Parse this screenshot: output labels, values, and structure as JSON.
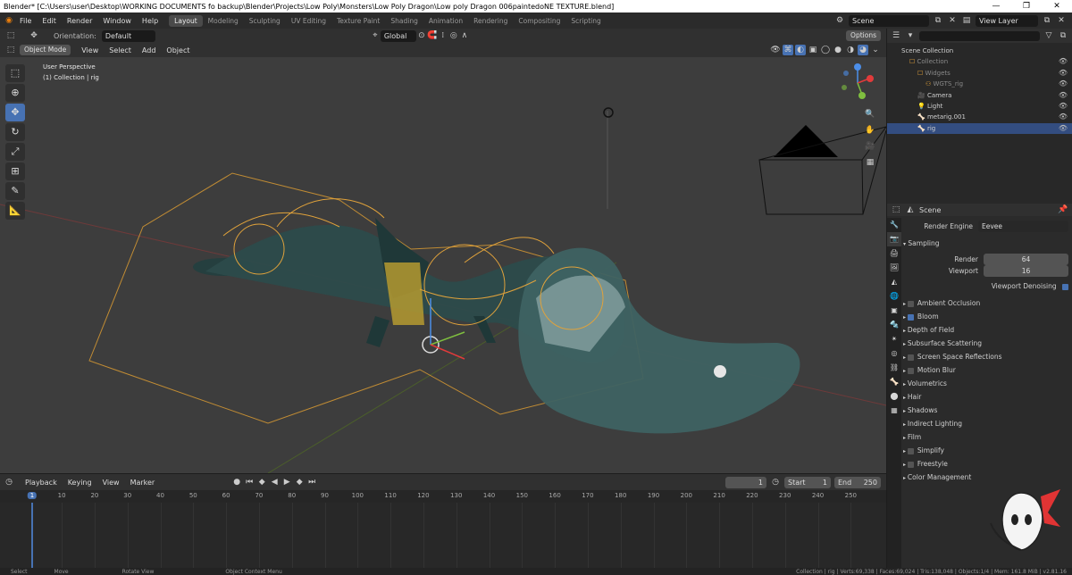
{
  "window": {
    "title": "Blender* [C:\\Users\\user\\Desktop\\WORKING DOCUMENTS fo backup\\Blender\\Projects\\Low Poly\\Monsters\\Low Poly Dragon\\Low poly Dragon 006paintedoNE TEXTURE.blend]",
    "minimize": "—",
    "maximize": "❐",
    "close": "✕"
  },
  "menu": [
    "File",
    "Edit",
    "Render",
    "Window",
    "Help"
  ],
  "workspaces": [
    "Layout",
    "Modeling",
    "Sculpting",
    "UV Editing",
    "Texture Paint",
    "Shading",
    "Animation",
    "Rendering",
    "Compositing",
    "Scripting"
  ],
  "scene_selector": {
    "scene": "Scene",
    "view_layer": "View Layer"
  },
  "tool_header": {
    "orientation_label": "Orientation:",
    "orientation_value": "Default",
    "transform_orientation": "Global",
    "options": "Options"
  },
  "viewport_header": {
    "mode": "Object Mode",
    "menus": [
      "View",
      "Select",
      "Add",
      "Object"
    ]
  },
  "viewport": {
    "info_line1": "User Perspective",
    "info_line2": "(1) Collection | rig"
  },
  "outliner": {
    "root": "Scene Collection",
    "items": [
      {
        "name": "Collection",
        "indent": 1,
        "dim": true
      },
      {
        "name": "Widgets",
        "indent": 2,
        "dim": true
      },
      {
        "name": "WGTS_rig",
        "indent": 3,
        "dim": true
      },
      {
        "name": "Camera",
        "indent": 2,
        "dim": false
      },
      {
        "name": "Light",
        "indent": 2,
        "dim": false
      },
      {
        "name": "metarig.001",
        "indent": 2,
        "dim": false
      },
      {
        "name": "rig",
        "indent": 2,
        "dim": false,
        "selected": true
      }
    ]
  },
  "properties": {
    "context": "Scene",
    "render_engine_label": "Render Engine",
    "render_engine": "Eevee",
    "sampling": {
      "title": "Sampling",
      "render_label": "Render",
      "render_value": "64",
      "viewport_label": "Viewport",
      "viewport_value": "16",
      "denoise_label": "Viewport Denoising"
    },
    "panels": [
      {
        "label": "Ambient Occlusion",
        "checkbox": true,
        "checked": false
      },
      {
        "label": "Bloom",
        "checkbox": true,
        "checked": true
      },
      {
        "label": "Depth of Field",
        "checkbox": false
      },
      {
        "label": "Subsurface Scattering",
        "checkbox": false
      },
      {
        "label": "Screen Space Reflections",
        "checkbox": true,
        "checked": false
      },
      {
        "label": "Motion Blur",
        "checkbox": true,
        "checked": false
      },
      {
        "label": "Volumetrics",
        "checkbox": false
      },
      {
        "label": "Hair",
        "checkbox": false
      },
      {
        "label": "Shadows",
        "checkbox": false
      },
      {
        "label": "Indirect Lighting",
        "checkbox": false
      },
      {
        "label": "Film",
        "checkbox": false
      },
      {
        "label": "Simplify",
        "checkbox": true,
        "checked": false
      },
      {
        "label": "Freestyle",
        "checkbox": true,
        "checked": false
      },
      {
        "label": "Color Management",
        "checkbox": false
      }
    ]
  },
  "timeline": {
    "menus": [
      "Playback",
      "Keying",
      "View",
      "Marker"
    ],
    "current_frame": "1",
    "start_label": "Start",
    "start": "1",
    "end_label": "End",
    "end": "250",
    "ruler": [
      "1",
      "10",
      "20",
      "30",
      "40",
      "50",
      "60",
      "70",
      "80",
      "90",
      "100",
      "110",
      "120",
      "130",
      "140",
      "150",
      "160",
      "170",
      "180",
      "190",
      "200",
      "210",
      "220",
      "230",
      "240",
      "250"
    ]
  },
  "status_bar": {
    "select": "Select",
    "move": "Move",
    "rotate": "Rotate View",
    "context_menu": "Object Context Menu",
    "stats": "Collection | rig | Verts:69,338 | Faces:69,024 | Tris:138,048 | Objects:1/4 | Mem: 161.8 MiB | v2.81.16"
  },
  "colors": {
    "accent": "#4772b3",
    "rig_wire": "#e8a53a",
    "dragon_body": "#2f4f4f",
    "grid_x": "#8a3b3b",
    "grid_y": "#5e7a2e",
    "playhead": "#4772b3"
  }
}
